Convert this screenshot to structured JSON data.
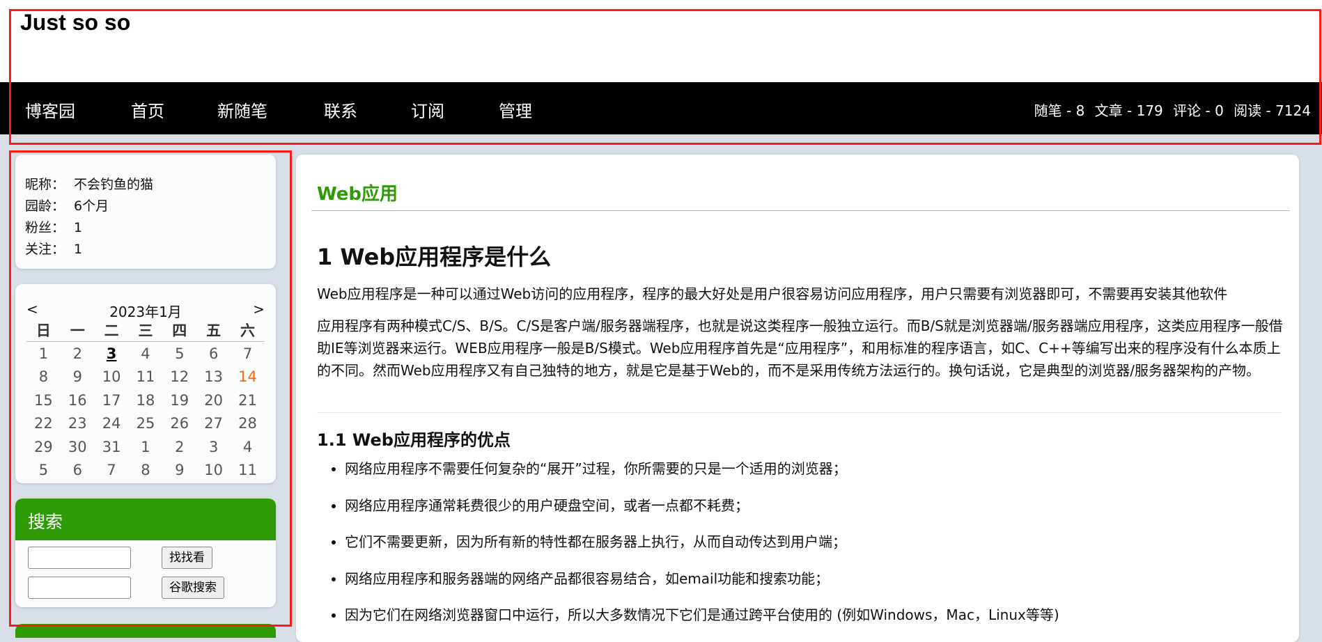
{
  "header": {
    "blog_title": "Just so so"
  },
  "nav": {
    "items": [
      "博客园",
      "首页",
      "新随笔",
      "联系",
      "订阅",
      "管理"
    ],
    "stats": {
      "posts": "随笔 - 8",
      "articles": "文章 - 179",
      "comments": "评论 - 0",
      "reads": "阅读 - 7124"
    }
  },
  "profile": {
    "rows": [
      {
        "label": "昵称：",
        "value": "不会钓鱼的猫"
      },
      {
        "label": "园龄：",
        "value": "6个月"
      },
      {
        "label": "粉丝：",
        "value": "1"
      },
      {
        "label": "关注：",
        "value": "1"
      }
    ]
  },
  "calendar": {
    "prev": "<",
    "next": ">",
    "title": "2023年1月",
    "weekdays": [
      "日",
      "一",
      "二",
      "三",
      "四",
      "五",
      "六"
    ],
    "weeks": [
      [
        "1",
        "2",
        "3",
        "4",
        "5",
        "6",
        "7"
      ],
      [
        "8",
        "9",
        "10",
        "11",
        "12",
        "13",
        "14"
      ],
      [
        "15",
        "16",
        "17",
        "18",
        "19",
        "20",
        "21"
      ],
      [
        "22",
        "23",
        "24",
        "25",
        "26",
        "27",
        "28"
      ],
      [
        "29",
        "30",
        "31",
        "1",
        "2",
        "3",
        "4"
      ],
      [
        "5",
        "6",
        "7",
        "8",
        "9",
        "10",
        "11"
      ]
    ],
    "today": "3",
    "marked": "14"
  },
  "search": {
    "title": "搜索",
    "find_button": "找找看",
    "google_button": "谷歌搜索"
  },
  "post": {
    "title": "Web应用",
    "h1": "1 Web应用程序是什么",
    "p1": "Web应用程序是一种可以通过Web访问的应用程序，程序的最大好处是用户很容易访问应用程序，用户只需要有浏览器即可，不需要再安装其他软件",
    "p2": "应用程序有两种模式C/S、B/S。C/S是客户端/服务器端程序，也就是说这类程序一般独立运行。而B/S就是浏览器端/服务器端应用程序，这类应用程序一般借助IE等浏览器来运行。WEB应用程序一般是B/S模式。Web应用程序首先是“应用程序”，和用标准的程序语言，如C、C++等编写出来的程序没有什么本质上的不同。然而Web应用程序又有自己独特的地方，就是它是基于Web的，而不是采用传统方法运行的。换句话说，它是典型的浏览器/服务器架构的产物。",
    "h2": "1.1 Web应用程序的优点",
    "advantages": [
      "网络应用程序不需要任何复杂的“展开”过程，你所需要的只是一个适用的浏览器；",
      "网络应用程序通常耗费很少的用户硬盘空间，或者一点都不耗费；",
      "它们不需要更新，因为所有新的特性都在服务器上执行，从而自动传达到用户端；",
      "网络应用程序和服务器端的网络产品都很容易结合，如email功能和搜索功能；",
      "因为它们在网络浏览器窗口中运行，所以大多数情况下它们是通过跨平台使用的 (例如Windows，Mac，Linux等等)"
    ]
  },
  "colors": {
    "accent_green": "#2d9a06",
    "nav_bg": "#000000",
    "highlight_red": "#ff1a1a",
    "marked_day": "#ff6600"
  }
}
